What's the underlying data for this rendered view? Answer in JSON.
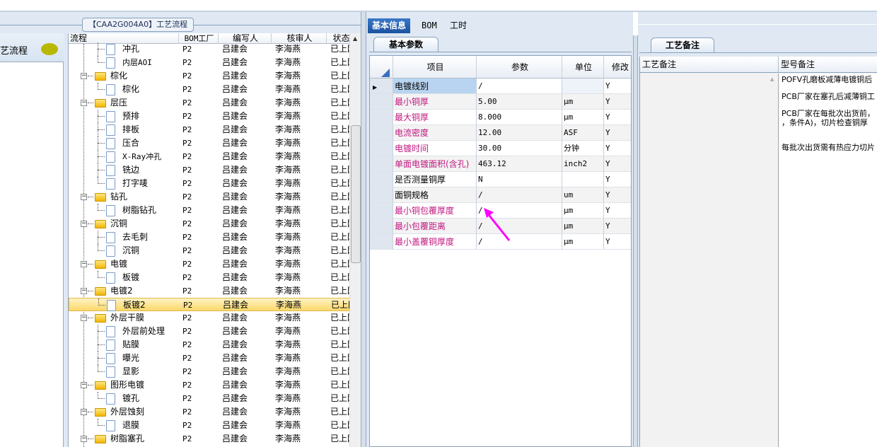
{
  "group_title": "【CAA2G004A0】工艺流程",
  "side_nav": {
    "label": "艺流程"
  },
  "tree_grid": {
    "columns": [
      "流程",
      "BOM工厂",
      "编写人",
      "核审人",
      "状态"
    ],
    "rows": [
      {
        "level": 2,
        "name": "冲孔",
        "bom": "P2",
        "author": "吕建会",
        "reviewer": "李海燕",
        "status": "已上网"
      },
      {
        "level": 2,
        "name": "内层AOI",
        "bom": "P2",
        "author": "吕建会",
        "reviewer": "李海燕",
        "status": "已上网"
      },
      {
        "level": 1,
        "name": "棕化",
        "bom": "P2",
        "author": "吕建会",
        "reviewer": "李海燕",
        "status": "已上网"
      },
      {
        "level": 2,
        "name": "棕化",
        "bom": "P2",
        "author": "吕建会",
        "reviewer": "李海燕",
        "status": "已上网"
      },
      {
        "level": 1,
        "name": "层压",
        "bom": "P2",
        "author": "吕建会",
        "reviewer": "李海燕",
        "status": "已上网"
      },
      {
        "level": 2,
        "name": "预排",
        "bom": "P2",
        "author": "吕建会",
        "reviewer": "李海燕",
        "status": "已上网"
      },
      {
        "level": 2,
        "name": "排板",
        "bom": "P2",
        "author": "吕建会",
        "reviewer": "李海燕",
        "status": "已上网"
      },
      {
        "level": 2,
        "name": "压合",
        "bom": "P2",
        "author": "吕建会",
        "reviewer": "李海燕",
        "status": "已上网"
      },
      {
        "level": 2,
        "name": "X-Ray冲孔",
        "bom": "P2",
        "author": "吕建会",
        "reviewer": "李海燕",
        "status": "已上网"
      },
      {
        "level": 2,
        "name": "铣边",
        "bom": "P2",
        "author": "吕建会",
        "reviewer": "李海燕",
        "status": "已上网"
      },
      {
        "level": 2,
        "name": "打字唛",
        "bom": "P2",
        "author": "吕建会",
        "reviewer": "李海燕",
        "status": "已上网"
      },
      {
        "level": 1,
        "name": "钻孔",
        "bom": "P2",
        "author": "吕建会",
        "reviewer": "李海燕",
        "status": "已上网"
      },
      {
        "level": 2,
        "name": "树脂钻孔",
        "bom": "P2",
        "author": "吕建会",
        "reviewer": "李海燕",
        "status": "已上网"
      },
      {
        "level": 1,
        "name": "沉铜",
        "bom": "P2",
        "author": "吕建会",
        "reviewer": "李海燕",
        "status": "已上网"
      },
      {
        "level": 2,
        "name": "去毛刺",
        "bom": "P2",
        "author": "吕建会",
        "reviewer": "李海燕",
        "status": "已上网"
      },
      {
        "level": 2,
        "name": "沉铜",
        "bom": "P2",
        "author": "吕建会",
        "reviewer": "李海燕",
        "status": "已上网"
      },
      {
        "level": 1,
        "name": "电镀",
        "bom": "P2",
        "author": "吕建会",
        "reviewer": "李海燕",
        "status": "已上网"
      },
      {
        "level": 2,
        "name": "板镀",
        "bom": "P2",
        "author": "吕建会",
        "reviewer": "李海燕",
        "status": "已上网"
      },
      {
        "level": 1,
        "name": "电镀2",
        "bom": "P2",
        "author": "吕建会",
        "reviewer": "李海燕",
        "status": "已上网"
      },
      {
        "level": 2,
        "name": "板镀2",
        "bom": "P2",
        "author": "吕建会",
        "reviewer": "李海燕",
        "status": "已上网",
        "selected": true
      },
      {
        "level": 1,
        "name": "外层干膜",
        "bom": "P2",
        "author": "吕建会",
        "reviewer": "李海燕",
        "status": "已上网"
      },
      {
        "level": 2,
        "name": "外层前处理",
        "bom": "P2",
        "author": "吕建会",
        "reviewer": "李海燕",
        "status": "已上网"
      },
      {
        "level": 2,
        "name": "贴膜",
        "bom": "P2",
        "author": "吕建会",
        "reviewer": "李海燕",
        "status": "已上网"
      },
      {
        "level": 2,
        "name": "曝光",
        "bom": "P2",
        "author": "吕建会",
        "reviewer": "李海燕",
        "status": "已上网"
      },
      {
        "level": 2,
        "name": "显影",
        "bom": "P2",
        "author": "吕建会",
        "reviewer": "李海燕",
        "status": "已上网"
      },
      {
        "level": 1,
        "name": "图形电镀",
        "bom": "P2",
        "author": "吕建会",
        "reviewer": "李海燕",
        "status": "已上网"
      },
      {
        "level": 2,
        "name": "镀孔",
        "bom": "P2",
        "author": "吕建会",
        "reviewer": "李海燕",
        "status": "已上网"
      },
      {
        "level": 1,
        "name": "外层蚀刻",
        "bom": "P2",
        "author": "吕建会",
        "reviewer": "李海燕",
        "status": "已上网"
      },
      {
        "level": 2,
        "name": "退膜",
        "bom": "P2",
        "author": "吕建会",
        "reviewer": "李海燕",
        "status": "已上网"
      },
      {
        "level": 1,
        "name": "树脂塞孔",
        "bom": "P2",
        "author": "吕建会",
        "reviewer": "李海燕",
        "status": "已上网"
      }
    ]
  },
  "mid_tabs": [
    "基本信息",
    "BOM",
    "工时"
  ],
  "param_subtab": "基本参数",
  "param_grid": {
    "columns": [
      "项目",
      "参数",
      "单位",
      "修改"
    ],
    "rows": [
      {
        "item": "电镀线别",
        "value": "/",
        "unit": "",
        "mod": "Y",
        "pink": false,
        "current": true
      },
      {
        "item": "最小铜厚",
        "value": "5.00",
        "unit": "μm",
        "mod": "Y",
        "pink": true
      },
      {
        "item": "最大铜厚",
        "value": "8.000",
        "unit": "μm",
        "mod": "Y",
        "pink": true
      },
      {
        "item": "电流密度",
        "value": "12.00",
        "unit": "ASF",
        "mod": "Y",
        "pink": true
      },
      {
        "item": "电镀时间",
        "value": "30.00",
        "unit": "分钟",
        "mod": "Y",
        "pink": true
      },
      {
        "item": "单面电镀面积(含孔)",
        "value": "463.12",
        "unit": "inch2",
        "mod": "Y",
        "pink": true
      },
      {
        "item": "是否测量铜厚",
        "value": "N",
        "unit": "",
        "mod": "Y",
        "pink": false
      },
      {
        "item": "面铜规格",
        "value": "/",
        "unit": "um",
        "mod": "Y",
        "pink": false
      },
      {
        "item": "最小铜包覆厚度",
        "value": "/",
        "unit": "μm",
        "mod": "Y",
        "pink": true
      },
      {
        "item": "最小包覆距离",
        "value": "/",
        "unit": "μm",
        "mod": "Y",
        "pink": true
      },
      {
        "item": "最小盖覆铜厚度",
        "value": "/",
        "unit": "μm",
        "mod": "Y",
        "pink": true
      }
    ]
  },
  "notes_subtab": "工艺备注",
  "notes_grid": {
    "columns": [
      "工艺备注",
      "型号备注"
    ],
    "model_notes": [
      "POFV孔磨板减薄电镀铜后",
      "PCB厂家在塞孔后减薄铜工",
      "PCB厂家在每批次出货前，\n，条件A)，切片检查铜厚",
      "每批次出货需有热应力切片"
    ]
  },
  "colors": {
    "accent": "#1a52a0",
    "pink_label": "#c01880",
    "annotation_arrow": "#ff00ff"
  }
}
